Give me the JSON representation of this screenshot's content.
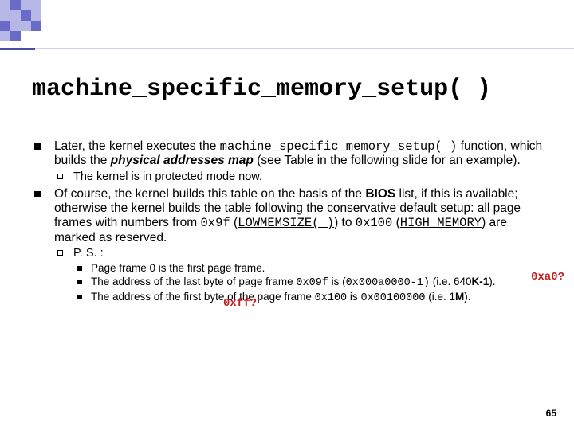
{
  "title": "machine_specific_memory_setup( )",
  "bullets": {
    "b1": {
      "pre": "Later, the kernel executes the ",
      "func": "machine_specific_memory_setup( )",
      "mid": " function, which builds the ",
      "map": "physical addresses map",
      "post": " (see Table in the following slide for an example).",
      "sub1": "The kernel is in protected mode now."
    },
    "b2": {
      "p1": "Of course, the kernel builds this table on the basis of the ",
      "bios": "BIOS",
      "p2": " list, if this is available; otherwise the kernel builds the table following the conservative default setup: all page frames with numbers from ",
      "hex1": "0x9f",
      "p3": " (",
      "low": "LOWMEMSIZE( )",
      "p4": ") to ",
      "hex2": "0x100",
      "p5": " (",
      "high": "HIGH_MEMORY",
      "p6": ") are marked as reserved.",
      "ps_label": "P. S. :",
      "ps1": "Page frame 0 is the first page frame.",
      "ps2a": "The address of the last byte of page frame ",
      "ps2h1": "0x09f",
      "ps2b": " is  (",
      "ps2h2": "0x000a0000-1)",
      "ps2c": " (i.e. 640",
      "ps2k": "K-1",
      "ps2d": ").",
      "ps3a": "The address of the first byte of the page frame ",
      "ps3h1": "0x100",
      "ps3b": " is ",
      "ps3h2": "0x00100000",
      "ps3c": " (i.e. 1",
      "ps3m": "M",
      "ps3d": ")."
    }
  },
  "annot1": "0xff?",
  "annot2": "0xa0?",
  "slide_num": "65"
}
